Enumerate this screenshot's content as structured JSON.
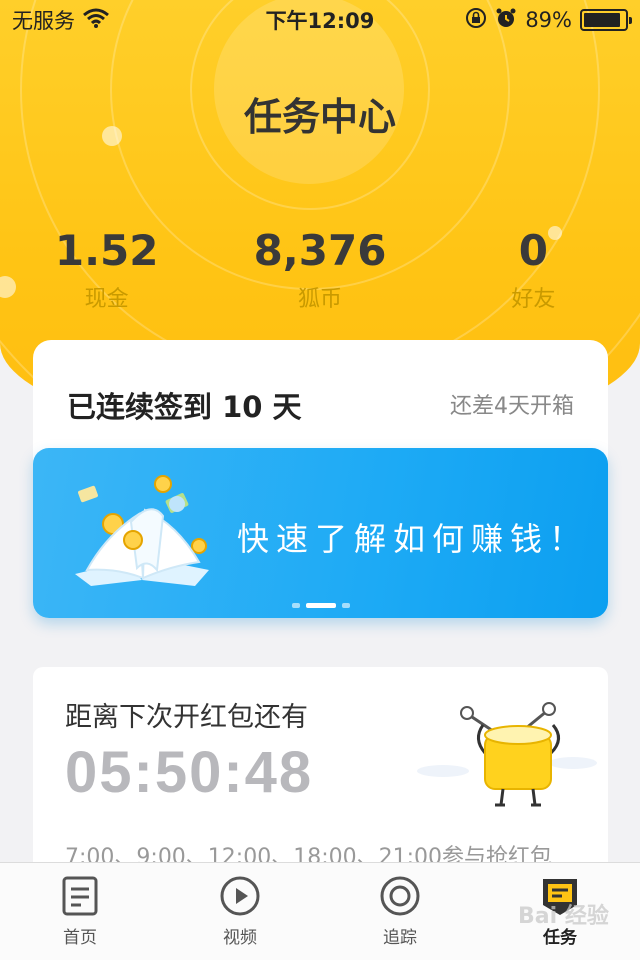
{
  "status_bar": {
    "carrier": "无服务",
    "time": "下午12:09",
    "battery": "89%",
    "battery_level": 0.89,
    "icons": [
      "wifi-icon",
      "orientation-lock-icon",
      "alarm-icon",
      "battery-icon"
    ]
  },
  "header": {
    "title": "任务中心"
  },
  "stats": [
    {
      "value": "1.52",
      "label": "现金"
    },
    {
      "value": "8,376",
      "label": "狐币"
    },
    {
      "value": "0",
      "label": "好友"
    }
  ],
  "signin": {
    "title": "已连续签到 10 天",
    "subtitle": "还差4天开箱"
  },
  "banner": {
    "text": "快速了解如何赚钱！",
    "pages": 3,
    "active_page": 2
  },
  "red_packet": {
    "title": "距离下次开红包还有",
    "countdown": "05:50:48",
    "schedule": "7:00、9:00、12:00、18:00、21:00参与抢红包"
  },
  "tabs": [
    {
      "label": "首页",
      "icon": "document-icon",
      "active": false
    },
    {
      "label": "视频",
      "icon": "play-circle-icon",
      "active": false
    },
    {
      "label": "追踪",
      "icon": "target-icon",
      "active": false
    },
    {
      "label": "任务",
      "icon": "task-badge-icon",
      "active": true
    }
  ],
  "watermark": "Bai 经验",
  "colors": {
    "accent_yellow": "#ffc414",
    "banner_blue": "#1daaf5",
    "background": "#f2f2f4"
  }
}
